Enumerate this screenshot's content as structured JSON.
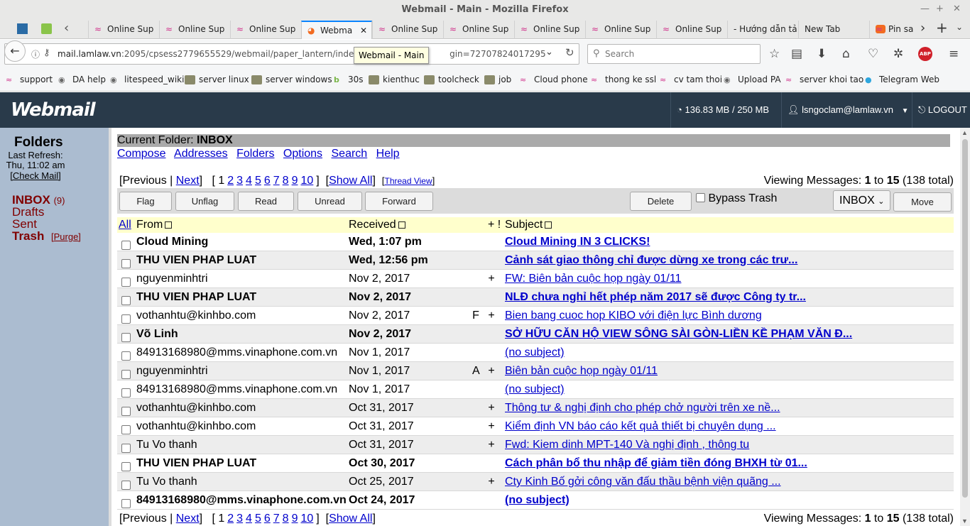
{
  "browser": {
    "window_title": "Webmail - Main - Mozilla Firefox",
    "tabs": [
      {
        "label": "Online Sup"
      },
      {
        "label": "Online Sup"
      },
      {
        "label": "Online Sup"
      },
      {
        "label": "Webma",
        "active": true
      },
      {
        "label": "Online Sup"
      },
      {
        "label": "Online Sup"
      },
      {
        "label": "Online Sup"
      },
      {
        "label": "Online Sup"
      },
      {
        "label": "Online Sup"
      },
      {
        "label": "- Hướng dẫn tả"
      },
      {
        "label": "New Tab"
      },
      {
        "label": "Pin sa"
      }
    ],
    "url_host": "mail.lamlaw.vn",
    "url_rest": ":2095/cpsess2779655529/webmail/paper_lantern/index.htm",
    "url_tail": "gin=72707824017295",
    "tooltip": "Webmail - Main",
    "search_placeholder": "Search",
    "abp_label": "ABP",
    "bookmarks": [
      {
        "label": "support",
        "icon": "cpanel-icon"
      },
      {
        "label": "DA help",
        "icon": "globe-icon"
      },
      {
        "label": "litespeed_wiki",
        "icon": "globe-icon"
      },
      {
        "label": "server linux",
        "icon": "folder-icon"
      },
      {
        "label": "server windows",
        "icon": "folder-icon"
      },
      {
        "label": "30s",
        "icon": "b-icon"
      },
      {
        "label": "kienthuc",
        "icon": "folder-icon"
      },
      {
        "label": "toolcheck",
        "icon": "folder-icon"
      },
      {
        "label": "job",
        "icon": "folder-icon"
      },
      {
        "label": "Cloud phone",
        "icon": "cpanel-icon"
      },
      {
        "label": "thong ke ssl",
        "icon": "cpanel-icon"
      },
      {
        "label": "cv tam thoi",
        "icon": "cpanel-icon"
      },
      {
        "label": "Upload PA",
        "icon": "globe-icon"
      },
      {
        "label": "server khoi tao",
        "icon": "cpanel-icon"
      },
      {
        "label": "Telegram Web",
        "icon": "telegram-icon"
      }
    ]
  },
  "webmail": {
    "logo": "Webmail",
    "quota": "136.83 MB / 250 MB",
    "user": "lsngoclam@lamlaw.vn",
    "logout": "LOGOUT"
  },
  "left": {
    "title": "Folders",
    "last_refresh_label": "Last Refresh:",
    "last_refresh_time": "Thu, 11:02 am",
    "check_mail": "[Check Mail]",
    "inbox": "INBOX",
    "inbox_count": "(9)",
    "drafts": "Drafts",
    "sent": "Sent",
    "trash": "Trash",
    "purge": "[Purge]"
  },
  "main": {
    "current_folder_label": "Current Folder: ",
    "current_folder": "INBOX",
    "links": [
      "Compose",
      "Addresses",
      "Folders",
      "Options",
      "Search",
      "Help"
    ],
    "pager": {
      "previous": "Previous",
      "next": "Next",
      "pages": [
        "1",
        "2",
        "3",
        "4",
        "5",
        "6",
        "7",
        "8",
        "9",
        "10"
      ],
      "show_all": "Show All",
      "thread_view": "Thread View",
      "viewing_label": "Viewing Messages: ",
      "from_n": "1",
      "to_label": " to ",
      "to_n": "15",
      "total": " (138 total)"
    },
    "buttons": {
      "flag": "Flag",
      "unflag": "Unflag",
      "read": "Read",
      "unread": "Unread",
      "forward": "Forward",
      "delete": "Delete",
      "bypass_trash": "Bypass Trash",
      "folder_select": "INBOX",
      "move": "Move"
    },
    "columns": {
      "all": "All",
      "from": "From",
      "received": "Received",
      "flags": "+ !",
      "subject": "Subject"
    },
    "messages": [
      {
        "from": "Cloud Mining",
        "received": "Wed, 1:07 pm",
        "flag": "",
        "plus": "",
        "subject": "Cloud Mining IN 3 CLICKS!",
        "unread": true
      },
      {
        "from": "THU VIEN PHAP LUAT",
        "received": "Wed, 12:56 pm",
        "flag": "",
        "plus": "",
        "subject": "Cảnh sát giao thông chỉ được dừng xe trong các trư...",
        "unread": true
      },
      {
        "from": "nguyenminhtri",
        "received": "Nov 2, 2017",
        "flag": "",
        "plus": "+",
        "subject": "FW: Biên bản cuộc họp ngày 01/11",
        "unread": false
      },
      {
        "from": "THU VIEN PHAP LUAT",
        "received": "Nov 2, 2017",
        "flag": "",
        "plus": "",
        "subject": "NLĐ chưa nghỉ hết phép năm 2017 sẽ được Công ty tr...",
        "unread": true
      },
      {
        "from": "vothanhtu@kinhbo.com",
        "received": "Nov 2, 2017",
        "flag": "F",
        "plus": "+",
        "subject": "Bien bang cuoc hop KIBO với điện lực Bình dương",
        "unread": false
      },
      {
        "from": "Võ Linh",
        "received": "Nov 2, 2017",
        "flag": "",
        "plus": "",
        "subject": "SỞ HỮU CĂN HỘ VIEW SÔNG SÀI GÒN-LIỀN KỀ PHẠM VĂN Đ...",
        "unread": true
      },
      {
        "from": "84913168980@mms.vinaphone.com.vn",
        "received": "Nov 1, 2017",
        "flag": "",
        "plus": "",
        "subject": "(no subject)",
        "unread": false
      },
      {
        "from": "nguyenminhtri",
        "received": "Nov 1, 2017",
        "flag": "A",
        "plus": "+",
        "subject": "Biên bản cuộc họp ngày 01/11",
        "unread": false
      },
      {
        "from": "84913168980@mms.vinaphone.com.vn",
        "received": "Nov 1, 2017",
        "flag": "",
        "plus": "",
        "subject": "(no subject)",
        "unread": false
      },
      {
        "from": "vothanhtu@kinhbo.com",
        "received": "Oct 31, 2017",
        "flag": "",
        "plus": "+",
        "subject": "Thông tư & nghị định cho phép chở người trên xe nề...",
        "unread": false
      },
      {
        "from": "vothanhtu@kinhbo.com",
        "received": "Oct 31, 2017",
        "flag": "",
        "plus": "+",
        "subject": "Kiểm định VN báo cáo kết quả thiết bị chuyên dụng ...",
        "unread": false
      },
      {
        "from": "Tu Vo thanh",
        "received": "Oct 31, 2017",
        "flag": "",
        "plus": "+",
        "subject": "Fwd: Kiem dinh MPT-140 Và nghị định , thông tu",
        "unread": false
      },
      {
        "from": "THU VIEN PHAP LUAT",
        "received": "Oct 30, 2017",
        "flag": "",
        "plus": "",
        "subject": "Cách phân bổ thu nhập để giảm tiền đóng BHXH từ 01...",
        "unread": true
      },
      {
        "from": "Tu Vo thanh",
        "received": "Oct 25, 2017",
        "flag": "",
        "plus": "+",
        "subject": "Cty Kinh Bố gởi công văn đấu thầu bệnh viện quãng ...",
        "unread": false
      },
      {
        "from": "84913168980@mms.vinaphone.com.vn",
        "received": "Oct 24, 2017",
        "flag": "",
        "plus": "",
        "subject": "(no subject)",
        "unread": true
      }
    ]
  }
}
